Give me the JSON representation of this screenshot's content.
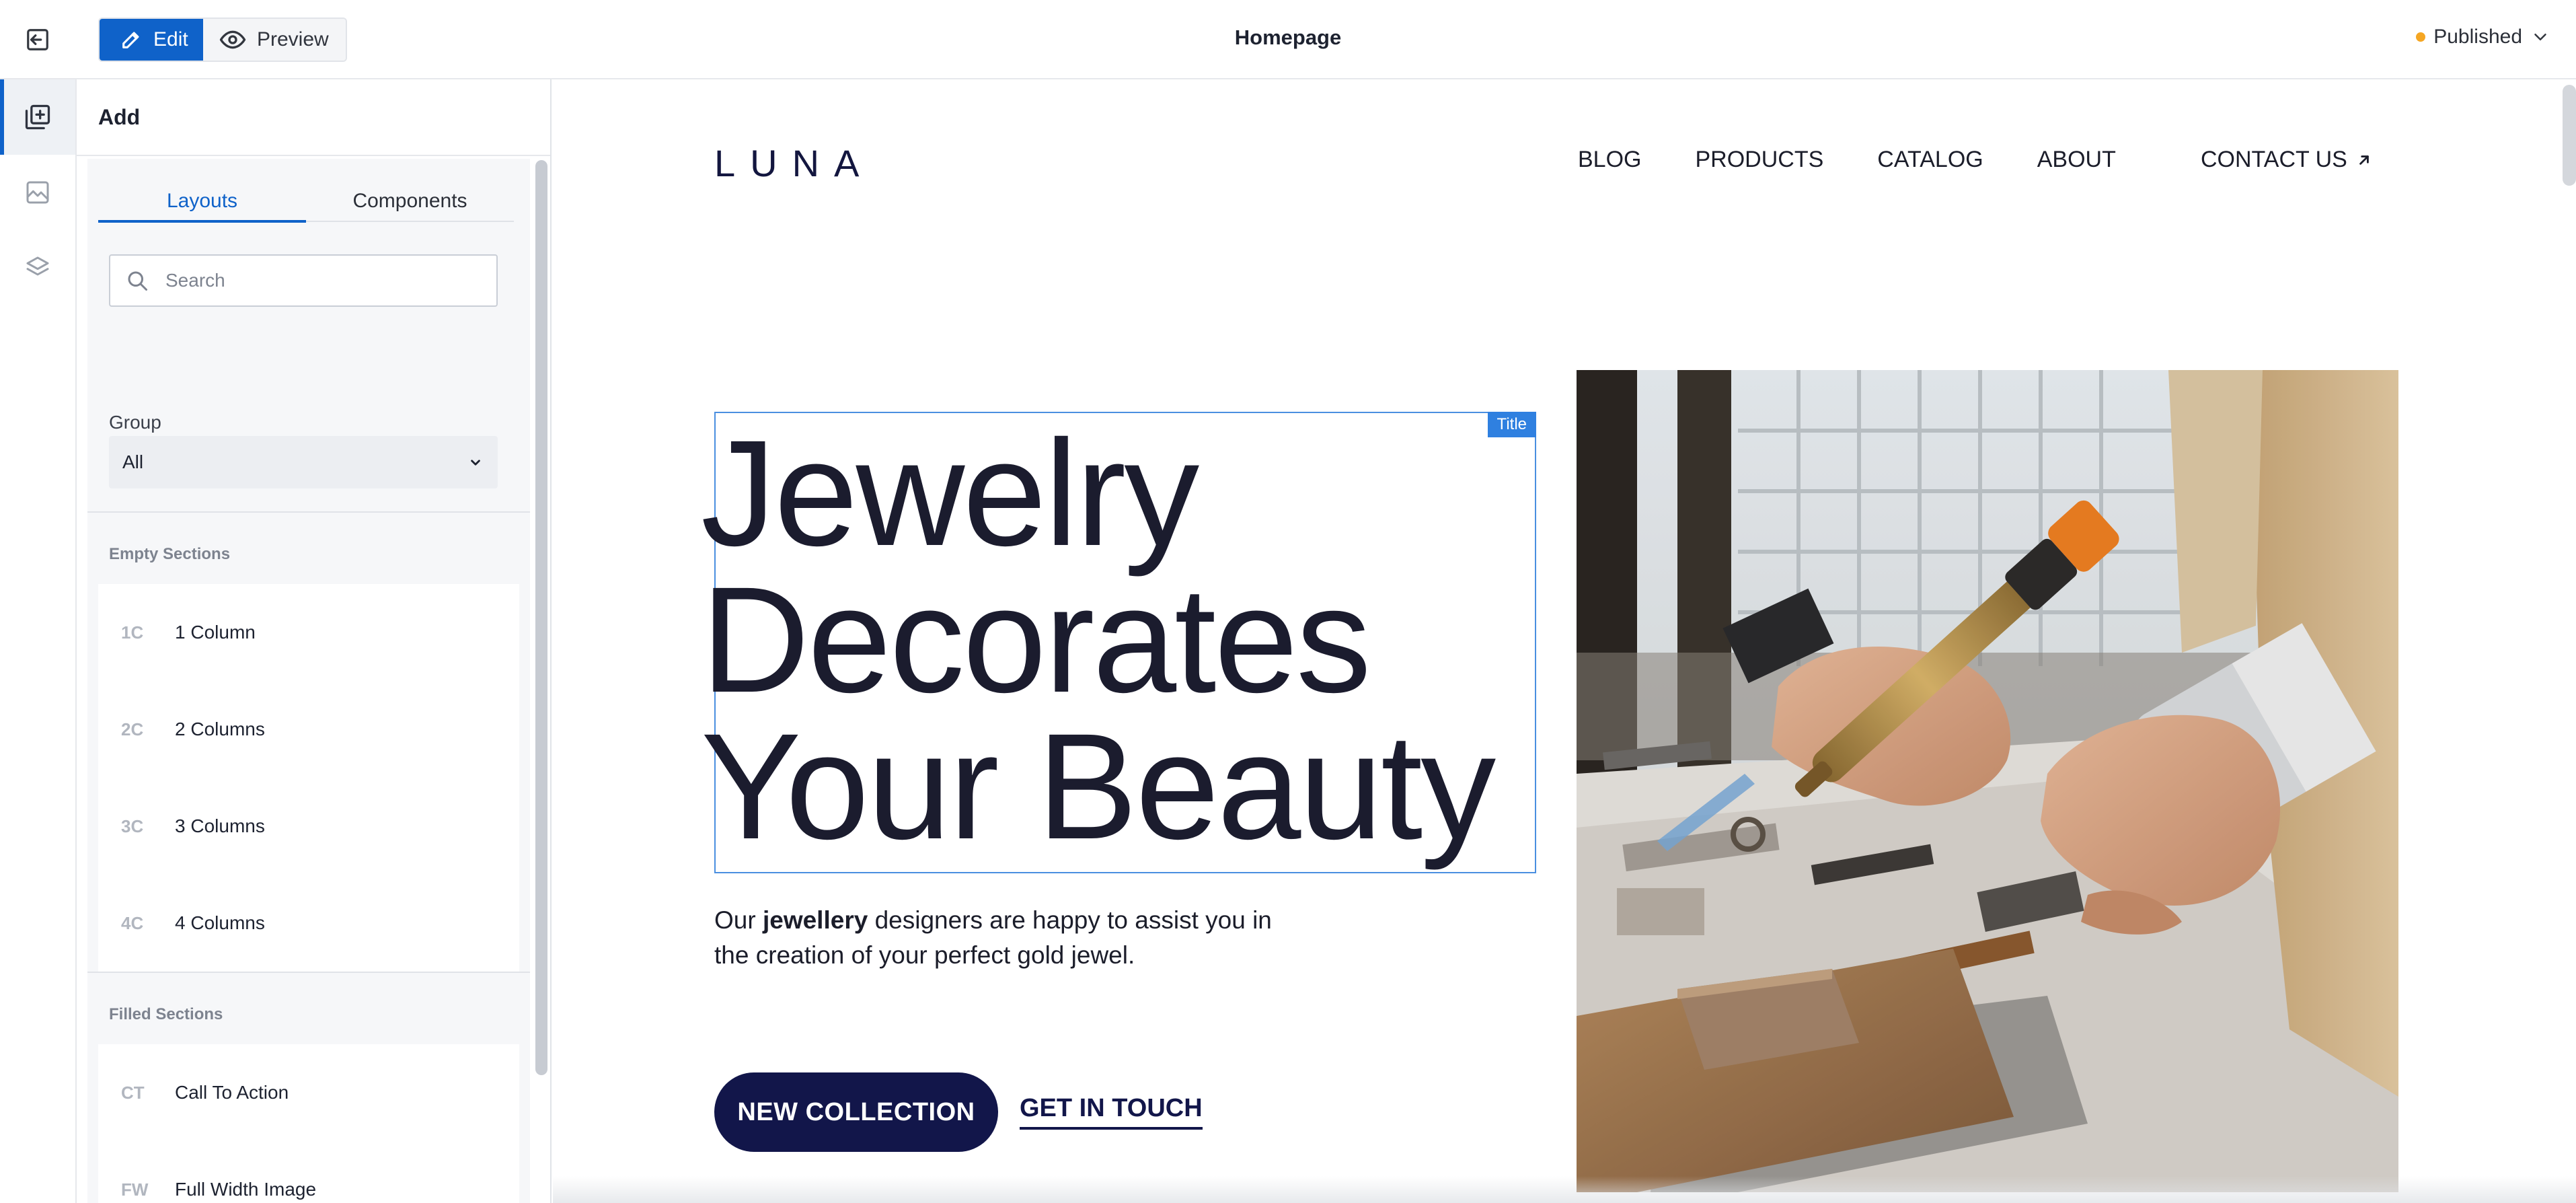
{
  "topbar": {
    "edit_label": "Edit",
    "preview_label": "Preview",
    "page_name": "Homepage",
    "status_label": "Published",
    "status_color": "#f5a623",
    "accent_color": "#0f62c9"
  },
  "rail": {
    "items": [
      {
        "icon": "add-section-icon",
        "active": true
      },
      {
        "icon": "image-icon",
        "active": false
      },
      {
        "icon": "layers-icon",
        "active": false
      }
    ]
  },
  "panel": {
    "title": "Add",
    "tabs": [
      {
        "label": "Layouts",
        "active": true
      },
      {
        "label": "Components",
        "active": false
      }
    ],
    "search": {
      "placeholder": "Search",
      "value": ""
    },
    "group": {
      "label": "Group",
      "value": "All"
    },
    "empty_sections": {
      "title": "Empty Sections",
      "items": [
        {
          "abbr": "1C",
          "label": "1 Column"
        },
        {
          "abbr": "2C",
          "label": "2 Columns"
        },
        {
          "abbr": "3C",
          "label": "3 Columns"
        },
        {
          "abbr": "4C",
          "label": "4 Columns"
        }
      ]
    },
    "filled_sections": {
      "title": "Filled Sections",
      "items": [
        {
          "abbr": "CT",
          "label": "Call To Action"
        },
        {
          "abbr": "FW",
          "label": "Full Width Image"
        }
      ]
    }
  },
  "site": {
    "logo": "LUNA",
    "nav": [
      "BLOG",
      "PRODUCTS",
      "CATALOG",
      "ABOUT"
    ],
    "contact_label": "CONTACT US",
    "title_tag": "Title",
    "hero_title_lines": [
      "Jewelry",
      "Decorates",
      "Your Beauty"
    ],
    "hero_desc_before": "Our ",
    "hero_desc_bold": "jewellery",
    "hero_desc_after": " designers are happy to assist you in the creation of your perfect gold jewel.",
    "primary_button": "NEW COLLECTION",
    "secondary_button": "GET IN TOUCH",
    "brand_color": "#12164a"
  }
}
